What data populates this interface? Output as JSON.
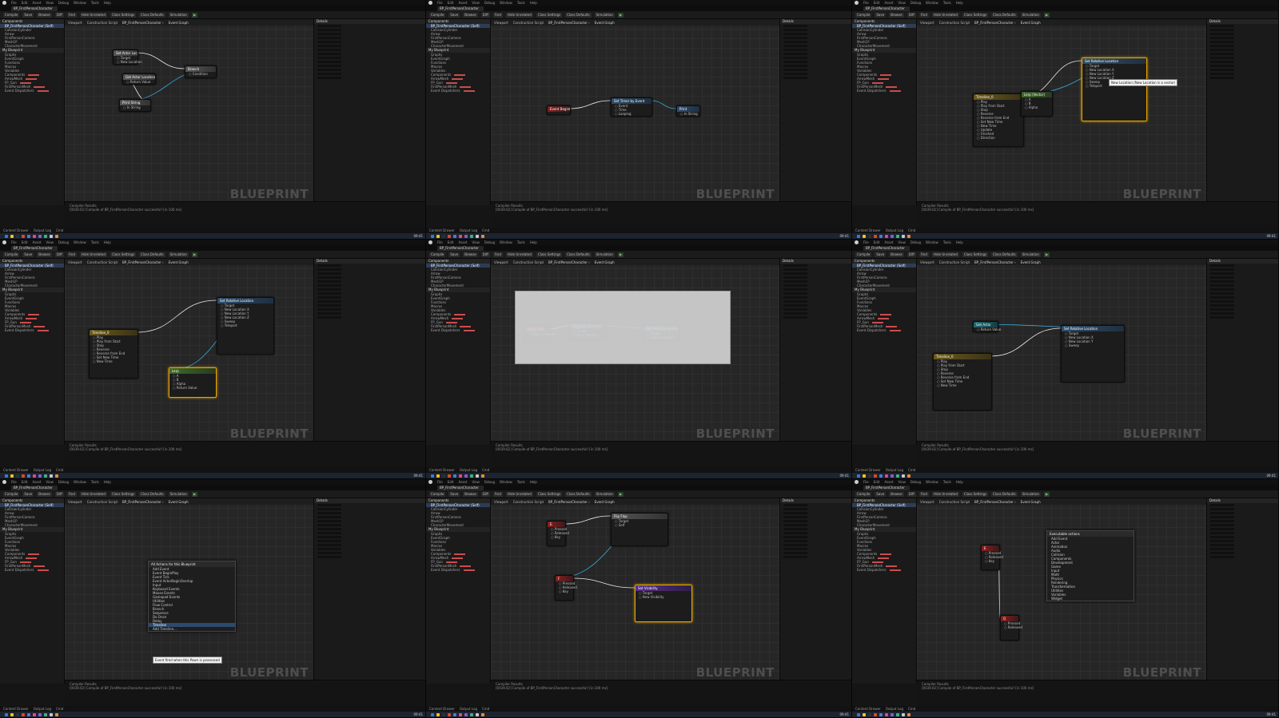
{
  "watermark": "BLUEPRINT",
  "menubar": [
    "File",
    "Edit",
    "Asset",
    "View",
    "Debug",
    "Window",
    "Tools",
    "Help"
  ],
  "document_tab": "BP_FirstPersonCharacter",
  "toolbar": [
    "Compile",
    "Save",
    "Browse",
    "Diff",
    "Find",
    "Hide Unrelated",
    "Class Settings",
    "Class Defaults",
    "Simulation"
  ],
  "panels": {
    "components": "Components",
    "my_blueprint": "My Blueprint",
    "details": "Details",
    "viewport": "Viewport",
    "construction_script": "Construction Script",
    "event_graph": "Event Graph",
    "compiler_results": "Compiler Results"
  },
  "breadcrumb": {
    "root": "BP_FirstPersonCharacter",
    "leaf": "Event Graph"
  },
  "left_tree": [
    "BP_FirstPersonCharacter (Self)",
    "CollisionCylinder",
    "Arrow",
    "FirstPersonCamera",
    "Mesh1P",
    "CharacterMovement",
    "Graphs",
    "EventGraph",
    "Functions",
    "Macros",
    "Variables",
    "Components",
    "ArrowMesh",
    "FP_Gun",
    "FirstPersonMesh",
    "Event Dispatchers"
  ],
  "drawer": [
    "Content Drawer",
    "Output Log",
    "Cmd"
  ],
  "output_text": "[0039.02] Compile of BP_FirstPersonCharacter successful! [in 100 ms]",
  "taskbar_colors": [
    "#2d7de0",
    "#f2c811",
    "#2f2f2f",
    "#d84a2f",
    "#4b7bd6",
    "#e04a8a",
    "#8a5ad6",
    "#3fb37f",
    "#c9c9c9",
    "#f08c2f"
  ],
  "clock": "09:41",
  "tiles": [
    {
      "id": "tile-1",
      "layout": "normal",
      "nodes": [
        {
          "title": "Set Actor Location",
          "color": "gray",
          "pins": [
            "Target",
            "New Location"
          ]
        },
        {
          "title": "Branch",
          "color": "gray",
          "pins": [
            "Condition"
          ]
        },
        {
          "title": "Print String",
          "color": "gray",
          "pins": [
            "In String"
          ]
        },
        {
          "title": "Get Actor Location",
          "color": "gray",
          "pins": [
            "Return Value"
          ]
        }
      ]
    },
    {
      "id": "tile-2",
      "layout": "wide",
      "nodes": [
        {
          "title": "Event BeginPlay",
          "color": "red",
          "pins": []
        },
        {
          "title": "Set Timer by Event",
          "color": "blue",
          "pins": [
            "Event",
            "Time",
            "Looping"
          ]
        },
        {
          "title": "Print",
          "color": "blue",
          "pins": [
            "In String"
          ]
        }
      ]
    },
    {
      "id": "tile-3",
      "layout": "wide",
      "nodes": [
        {
          "title": "Timeline_0",
          "color": "olive",
          "pins": [
            "Play",
            "Play from Start",
            "Stop",
            "Reverse",
            "Reverse from End",
            "Set New Time",
            "New Time",
            "Update",
            "Finished",
            "Direction"
          ]
        },
        {
          "title": "Set Relative Location",
          "color": "blue",
          "pins": [
            "Target",
            "New Location X",
            "New Location Y",
            "New Location Z",
            "Sweep",
            "Teleport"
          ]
        },
        {
          "title": "Lerp (Vector)",
          "color": "green",
          "pins": [
            "A",
            "B",
            "Alpha"
          ]
        }
      ],
      "tooltip": "New Location (New Location is a vector)"
    },
    {
      "id": "tile-4",
      "layout": "normal",
      "nodes": [
        {
          "title": "Timeline_0",
          "color": "olive",
          "pins": [
            "Play",
            "Play from Start",
            "Stop",
            "Reverse",
            "Reverse from End",
            "Set New Time",
            "New Time"
          ]
        },
        {
          "title": "Set Relative Location",
          "color": "blue",
          "pins": [
            "Target",
            "New Location X",
            "New Location Y",
            "New Location Z",
            "Sweep",
            "Teleport"
          ]
        },
        {
          "title": "Lerp",
          "color": "green",
          "pins": [
            "A",
            "B",
            "Alpha",
            "Return Value"
          ]
        }
      ]
    },
    {
      "id": "tile-5",
      "layout": "wide",
      "nodes": [
        {
          "title": "Event Tick",
          "color": "red",
          "pins": [
            "Delta Seconds"
          ]
        },
        {
          "title": "Set Actor Rotation",
          "color": "blue",
          "pins": [
            "Target",
            "New Rotation"
          ]
        },
        {
          "title": "Add Relative Rotation",
          "color": "blue",
          "pins": [
            "Target",
            "Delta Rotation"
          ]
        }
      ],
      "collapsed_label": "Collapsed Graph"
    },
    {
      "id": "tile-6",
      "layout": "wide",
      "nodes": [
        {
          "title": "Timeline_0",
          "color": "olive",
          "pins": [
            "Play",
            "Play from Start",
            "Stop",
            "Reverse",
            "Reverse from End",
            "Set New Time",
            "New Time"
          ]
        },
        {
          "title": "Set Relative Location",
          "color": "blue",
          "pins": [
            "Target",
            "New Location X",
            "New Location Y",
            "Sweep"
          ]
        },
        {
          "title": "Get Actor",
          "color": "teal",
          "pins": [
            "Return Value"
          ]
        }
      ]
    },
    {
      "id": "tile-7",
      "layout": "normal",
      "nodes": [],
      "context_menu": {
        "title": "All Actions for this Blueprint",
        "rows": [
          "Add Event",
          "Event BeginPlay",
          "Event Tick",
          "Event ActorBeginOverlap",
          "Input",
          "Keyboard Events",
          "Mouse Events",
          "Gamepad Events",
          "Utilities",
          "Flow Control",
          "Branch",
          "Sequence",
          "Do Once",
          "Delay",
          "Timeline",
          "Add Timeline..."
        ],
        "selected": 14
      },
      "tooltip": "Event fired when this Pawn is possessed"
    },
    {
      "id": "tile-8",
      "layout": "wide",
      "nodes": [
        {
          "title": "E",
          "color": "red",
          "pins": [
            "Pressed",
            "Released",
            "Key"
          ]
        },
        {
          "title": "Flip Flop",
          "color": "gray",
          "pins": [
            "Target",
            "Self"
          ]
        },
        {
          "title": "F",
          "color": "red",
          "pins": [
            "Pressed",
            "Released",
            "Key"
          ]
        },
        {
          "title": "Set Visibility",
          "color": "purple",
          "pins": [
            "Target",
            "New Visibility"
          ]
        }
      ]
    },
    {
      "id": "tile-9",
      "layout": "wide",
      "nodes": [
        {
          "title": "E",
          "color": "red",
          "pins": [
            "Pressed",
            "Released",
            "Key"
          ]
        },
        {
          "title": "Q",
          "color": "red",
          "pins": [
            "Pressed",
            "Released"
          ]
        }
      ],
      "context_menu": {
        "title": "Executable actions",
        "rows": [
          "Add Event",
          "Actor",
          "Animation",
          "Audio",
          "Collision",
          "Components",
          "Development",
          "Game",
          "Input",
          "Math",
          "Physics",
          "Rendering",
          "Transformation",
          "Utilities",
          "Variables",
          "Widget"
        ],
        "selected": -1
      }
    }
  ]
}
